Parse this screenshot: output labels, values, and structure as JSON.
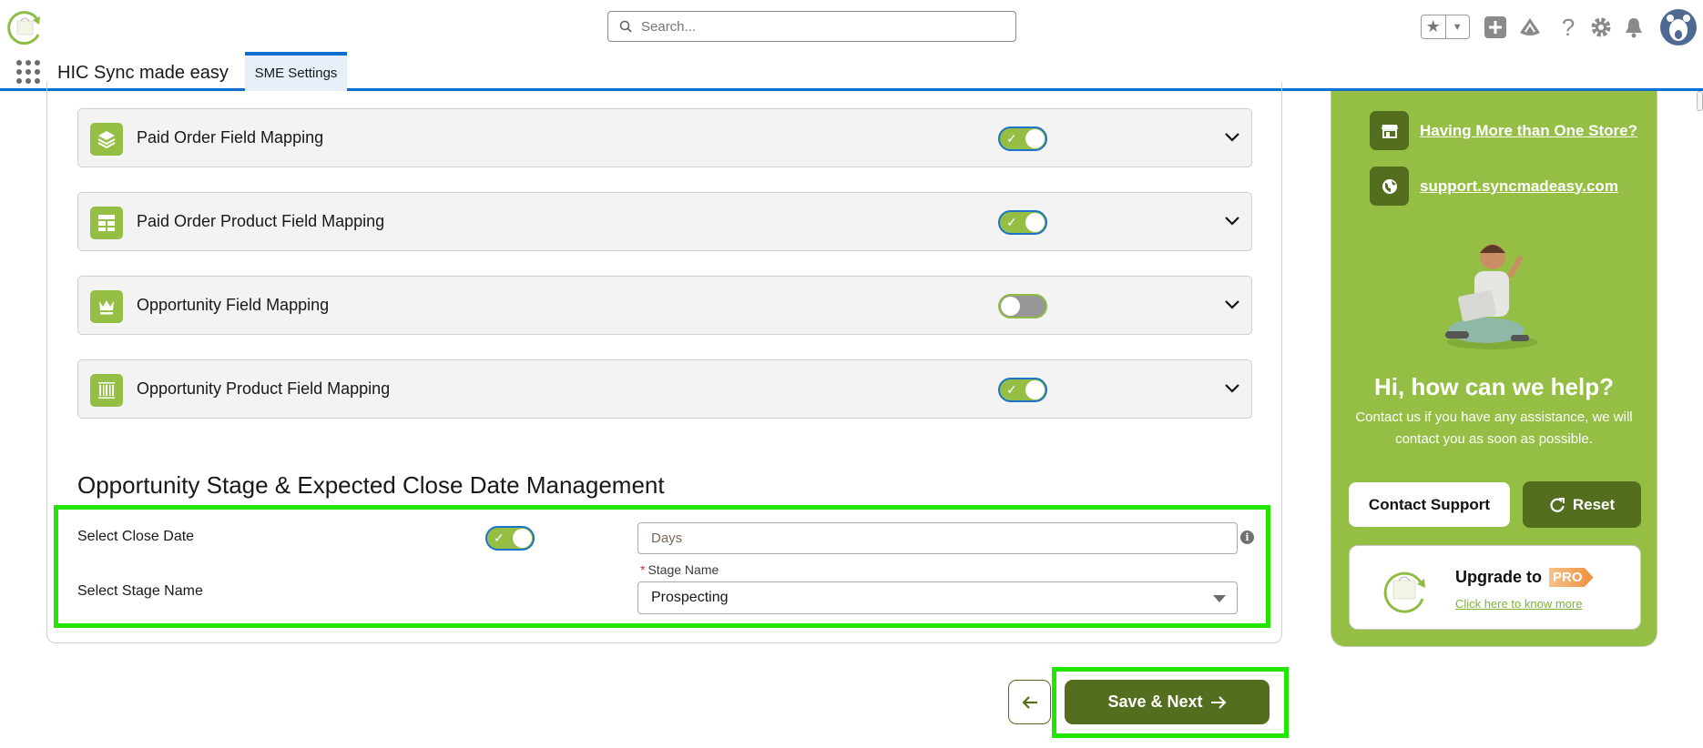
{
  "header": {
    "search_placeholder": "Search...",
    "app_name": "HIC Sync made easy",
    "tab_label": "SME Settings",
    "icons": [
      "favorites-star-icon",
      "chevron-down-icon",
      "add-icon",
      "trailhead-icon",
      "help-icon",
      "setup-gear-icon",
      "notifications-bell-icon",
      "avatar"
    ]
  },
  "mappings": [
    {
      "label": "Paid Order Field Mapping",
      "icon": "layers-icon",
      "enabled": true
    },
    {
      "label": "Paid Order Product Field Mapping",
      "icon": "table-icon",
      "enabled": true
    },
    {
      "label": "Opportunity Field Mapping",
      "icon": "crown-icon",
      "enabled": false
    },
    {
      "label": "Opportunity Product Field Mapping",
      "icon": "barcode-icon",
      "enabled": true
    }
  ],
  "stage_section": {
    "heading": "Opportunity Stage & Expected Close Date Management",
    "close_date_label": "Select Close Date",
    "close_date_enabled": true,
    "days_placeholder": "Days",
    "stage_name_label_text": "Select Stage Name",
    "stage_field_label": "Stage Name",
    "required_marker": "*",
    "stage_value": "Prospecting"
  },
  "footer": {
    "save_next_label": "Save & Next",
    "back_icon": "arrow-left-icon"
  },
  "panel": {
    "links": [
      {
        "label": "Having More than One Store?",
        "icon": "store-icon"
      },
      {
        "label": "support.syncmadeasy.com",
        "icon": "globe-icon"
      }
    ],
    "help_title": "Hi, how can we help?",
    "help_desc": "Contact us if you have any assistance, we will contact you as soon as possible.",
    "contact_label": "Contact Support",
    "reset_label": "Reset",
    "upgrade_title": "Upgrade to",
    "pro_badge": "PRO",
    "upgrade_link": "Click here to know more"
  },
  "colors": {
    "brand_green": "#95bf44",
    "dark_green": "#546e1f",
    "highlight": "#22e600",
    "accent_blue": "#0b6fd1"
  }
}
